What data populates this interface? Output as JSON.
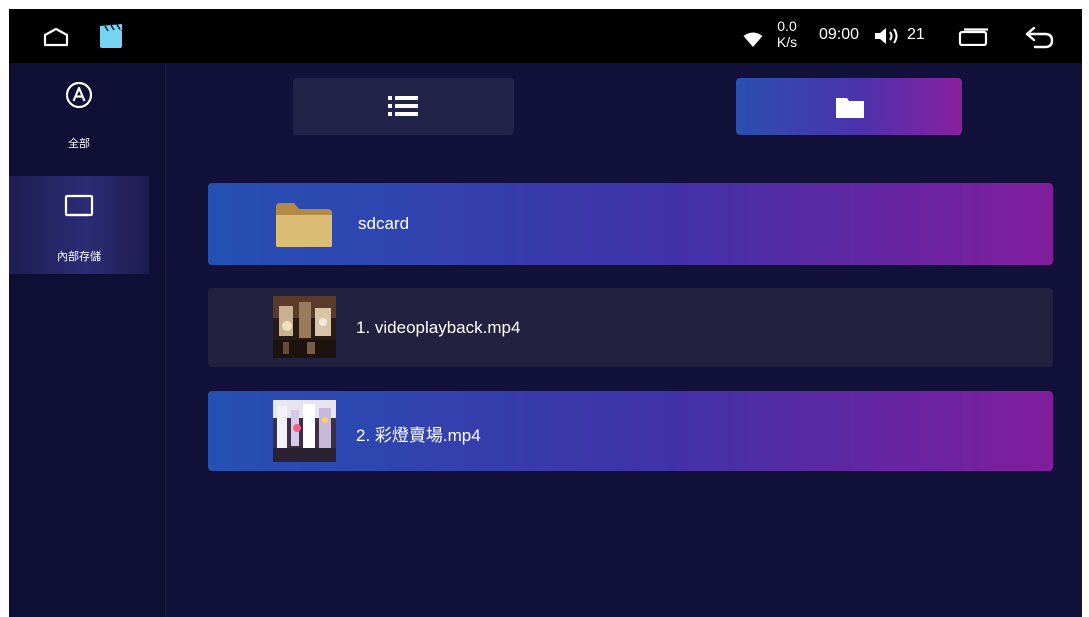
{
  "status_bar": {
    "icons": [
      "home-outline-icon",
      "video-clapper-icon",
      "wifi-icon",
      "volume-icon",
      "recent-apps-icon",
      "back-arrow-icon"
    ],
    "net_speed_value": "0.0",
    "net_speed_unit": "K/s",
    "time": "09:00",
    "volume_level": "21"
  },
  "sidebar": {
    "items": [
      {
        "label": "全部",
        "icon": "circle-a-icon",
        "selected": false
      },
      {
        "label": "內部存儲",
        "icon": "storage-monitor-icon",
        "selected": true
      }
    ]
  },
  "view_tabs": [
    {
      "icon": "list-view-icon",
      "selected": false
    },
    {
      "icon": "folder-view-icon",
      "selected": true
    }
  ],
  "files": [
    {
      "name": "sdcard",
      "type": "folder",
      "icon": "folder-icon",
      "highlighted": true
    },
    {
      "name": "1. videoplayback.mp4",
      "type": "video",
      "highlighted": false
    },
    {
      "name": "2. 彩燈賣場.mp4",
      "type": "video",
      "highlighted": true
    }
  ],
  "colors": {
    "background": "#12113a",
    "status_bar": "#000000",
    "gradient_start": "#2451b4",
    "gradient_end": "#821d9d",
    "row_plain": "#22213f",
    "folder": "#d6b56a"
  }
}
